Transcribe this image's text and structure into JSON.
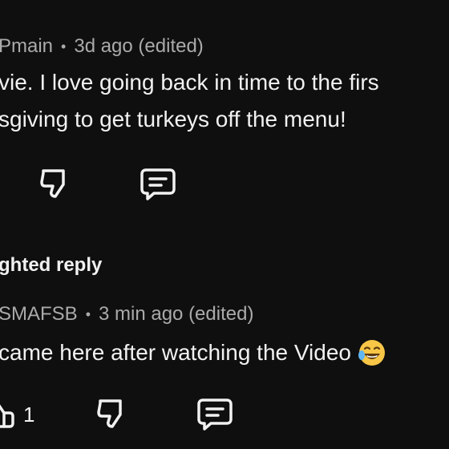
{
  "comment1": {
    "author": "Pmain",
    "separator": "•",
    "timestamp": "3d ago (edited)",
    "text_line1": "vie. I love going back in time to the firs",
    "text_line2": "sgiving to get turkeys off the menu!"
  },
  "section": {
    "label": "ghted reply"
  },
  "comment2": {
    "author": "SMAFSB",
    "separator": "•",
    "timestamp": "3 min ago (edited)",
    "text": "came here after watching the Video",
    "emoji": "laughing-tears-emoji",
    "like_count": "1"
  },
  "icons": {
    "dislike": "thumbs-down-icon",
    "reply": "comment-reply-icon",
    "like": "thumbs-up-icon"
  },
  "colors": {
    "background": "#0f0f0f",
    "primary_text": "#f1f1f1",
    "secondary_text": "#aaaaaa",
    "emoji_face": "#f7c646"
  }
}
